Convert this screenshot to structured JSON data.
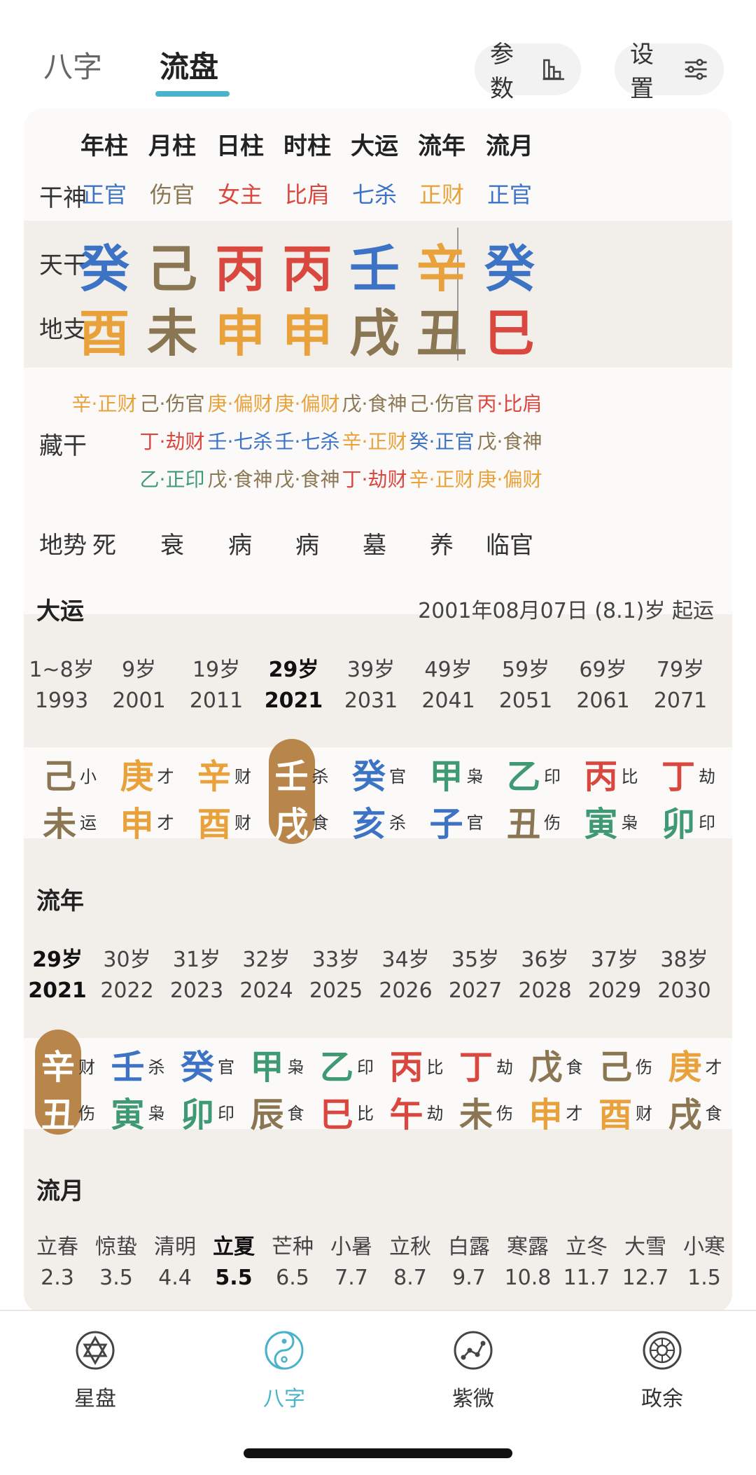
{
  "top_tabs": [
    {
      "label": "八字"
    },
    {
      "label": "流盘"
    }
  ],
  "top_buttons": {
    "params_label": "参数",
    "settings_label": "设置"
  },
  "pillars": {
    "headers": [
      "年柱",
      "月柱",
      "日柱",
      "时柱",
      "大运",
      "流年",
      "流月"
    ],
    "row_labels": {
      "gan_shen": "干神",
      "tian_gan": "天干",
      "di_zhi": "地支",
      "cang_gan": "藏干",
      "di_shi": "地势"
    },
    "gan_shen": [
      {
        "t": "正官",
        "c": "blue"
      },
      {
        "t": "伤官",
        "c": "brown"
      },
      {
        "t": "女主",
        "c": "red"
      },
      {
        "t": "比肩",
        "c": "red"
      },
      {
        "t": "七杀",
        "c": "blue"
      },
      {
        "t": "正财",
        "c": "orange"
      },
      {
        "t": "正官",
        "c": "blue"
      }
    ],
    "tian_gan": [
      {
        "t": "癸",
        "c": "blue"
      },
      {
        "t": "己",
        "c": "brown"
      },
      {
        "t": "丙",
        "c": "red"
      },
      {
        "t": "丙",
        "c": "red"
      },
      {
        "t": "壬",
        "c": "blue"
      },
      {
        "t": "辛",
        "c": "orange"
      },
      {
        "t": "癸",
        "c": "blue"
      }
    ],
    "di_zhi": [
      {
        "t": "酉",
        "c": "orange"
      },
      {
        "t": "未",
        "c": "brown"
      },
      {
        "t": "申",
        "c": "orange"
      },
      {
        "t": "申",
        "c": "orange"
      },
      {
        "t": "戌",
        "c": "brown"
      },
      {
        "t": "丑",
        "c": "brown"
      },
      {
        "t": "巳",
        "c": "red"
      }
    ],
    "cang_gan": [
      [
        {
          "t": "辛·正财",
          "c": "orange"
        }
      ],
      [
        {
          "t": "己·伤官",
          "c": "brown"
        },
        {
          "t": "丁·劫财",
          "c": "red"
        },
        {
          "t": "乙·正印",
          "c": "green"
        }
      ],
      [
        {
          "t": "庚·偏财",
          "c": "orange"
        },
        {
          "t": "壬·七杀",
          "c": "blue"
        },
        {
          "t": "戊·食神",
          "c": "brown"
        }
      ],
      [
        {
          "t": "庚·偏财",
          "c": "orange"
        },
        {
          "t": "壬·七杀",
          "c": "blue"
        },
        {
          "t": "戊·食神",
          "c": "brown"
        }
      ],
      [
        {
          "t": "戊·食神",
          "c": "brown"
        },
        {
          "t": "辛·正财",
          "c": "orange"
        },
        {
          "t": "丁·劫财",
          "c": "red"
        }
      ],
      [
        {
          "t": "己·伤官",
          "c": "brown"
        },
        {
          "t": "癸·正官",
          "c": "blue"
        },
        {
          "t": "辛·正财",
          "c": "orange"
        }
      ],
      [
        {
          "t": "丙·比肩",
          "c": "red"
        },
        {
          "t": "戊·食神",
          "c": "brown"
        },
        {
          "t": "庚·偏财",
          "c": "orange"
        }
      ]
    ],
    "di_shi": [
      "死",
      "衰",
      "病",
      "病",
      "墓",
      "养",
      "临官"
    ]
  },
  "dayun": {
    "title": "大运",
    "qiyun": "2001年08月07日 (8.1)岁 起运",
    "ages": [
      {
        "age": "1~8岁",
        "year": "1993"
      },
      {
        "age": "9岁",
        "year": "2001"
      },
      {
        "age": "19岁",
        "year": "2011"
      },
      {
        "age": "29岁",
        "year": "2021",
        "current": true
      },
      {
        "age": "39岁",
        "year": "2031"
      },
      {
        "age": "49岁",
        "year": "2041"
      },
      {
        "age": "59岁",
        "year": "2051"
      },
      {
        "age": "69岁",
        "year": "2061"
      },
      {
        "age": "79岁",
        "year": "2071"
      }
    ],
    "ganzhi": [
      {
        "g1": "己",
        "c1": "brown",
        "s1": "小",
        "g2": "未",
        "c2": "brown",
        "s2": "运"
      },
      {
        "g1": "庚",
        "c1": "orange",
        "s1": "才",
        "g2": "申",
        "c2": "orange",
        "s2": "才"
      },
      {
        "g1": "辛",
        "c1": "orange",
        "s1": "财",
        "g2": "酉",
        "c2": "orange",
        "s2": "财"
      },
      {
        "g1": "壬",
        "c1": "blue",
        "s1": "杀",
        "g2": "戌",
        "c2": "brown",
        "s2": "食",
        "current": true
      },
      {
        "g1": "癸",
        "c1": "blue",
        "s1": "官",
        "g2": "亥",
        "c2": "blue",
        "s2": "杀"
      },
      {
        "g1": "甲",
        "c1": "green",
        "s1": "枭",
        "g2": "子",
        "c2": "blue",
        "s2": "官"
      },
      {
        "g1": "乙",
        "c1": "green",
        "s1": "印",
        "g2": "丑",
        "c2": "brown",
        "s2": "伤"
      },
      {
        "g1": "丙",
        "c1": "red",
        "s1": "比",
        "g2": "寅",
        "c2": "green",
        "s2": "枭"
      },
      {
        "g1": "丁",
        "c1": "red",
        "s1": "劫",
        "g2": "卯",
        "c2": "green",
        "s2": "印"
      }
    ]
  },
  "liunian": {
    "title": "流年",
    "ages": [
      {
        "age": "29岁",
        "year": "2021",
        "current": true
      },
      {
        "age": "30岁",
        "year": "2022"
      },
      {
        "age": "31岁",
        "year": "2023"
      },
      {
        "age": "32岁",
        "year": "2024"
      },
      {
        "age": "33岁",
        "year": "2025"
      },
      {
        "age": "34岁",
        "year": "2026"
      },
      {
        "age": "35岁",
        "year": "2027"
      },
      {
        "age": "36岁",
        "year": "2028"
      },
      {
        "age": "37岁",
        "year": "2029"
      },
      {
        "age": "38岁",
        "year": "2030"
      }
    ],
    "ganzhi": [
      {
        "g1": "辛",
        "c1": "orange",
        "s1": "财",
        "g2": "丑",
        "c2": "brown",
        "s2": "伤",
        "current": true
      },
      {
        "g1": "壬",
        "c1": "blue",
        "s1": "杀",
        "g2": "寅",
        "c2": "green",
        "s2": "枭"
      },
      {
        "g1": "癸",
        "c1": "blue",
        "s1": "官",
        "g2": "卯",
        "c2": "green",
        "s2": "印"
      },
      {
        "g1": "甲",
        "c1": "green",
        "s1": "枭",
        "g2": "辰",
        "c2": "brown",
        "s2": "食"
      },
      {
        "g1": "乙",
        "c1": "green",
        "s1": "印",
        "g2": "巳",
        "c2": "red",
        "s2": "比"
      },
      {
        "g1": "丙",
        "c1": "red",
        "s1": "比",
        "g2": "午",
        "c2": "red",
        "s2": "劫"
      },
      {
        "g1": "丁",
        "c1": "red",
        "s1": "劫",
        "g2": "未",
        "c2": "brown",
        "s2": "伤"
      },
      {
        "g1": "戊",
        "c1": "brown",
        "s1": "食",
        "g2": "申",
        "c2": "orange",
        "s2": "才"
      },
      {
        "g1": "己",
        "c1": "brown",
        "s1": "伤",
        "g2": "酉",
        "c2": "orange",
        "s2": "财"
      },
      {
        "g1": "庚",
        "c1": "orange",
        "s1": "才",
        "g2": "戌",
        "c2": "brown",
        "s2": "食"
      }
    ]
  },
  "liuyue": {
    "title": "流月",
    "items": [
      {
        "name": "立春",
        "date": "2.3"
      },
      {
        "name": "惊蛰",
        "date": "3.5"
      },
      {
        "name": "清明",
        "date": "4.4"
      },
      {
        "name": "立夏",
        "date": "5.5",
        "current": true
      },
      {
        "name": "芒种",
        "date": "6.5"
      },
      {
        "name": "小暑",
        "date": "7.7"
      },
      {
        "name": "立秋",
        "date": "8.7"
      },
      {
        "name": "白露",
        "date": "9.7"
      },
      {
        "name": "寒露",
        "date": "10.8"
      },
      {
        "name": "立冬",
        "date": "11.7"
      },
      {
        "name": "大雪",
        "date": "12.7"
      },
      {
        "name": "小寒",
        "date": "1.5"
      }
    ]
  },
  "bottom_nav": [
    {
      "label": "星盘",
      "icon": "star-of-david-icon"
    },
    {
      "label": "八字",
      "icon": "yin-yang-icon",
      "active": true
    },
    {
      "label": "紫微",
      "icon": "constellation-icon"
    },
    {
      "label": "政余",
      "icon": "astrolabe-wheel-icon"
    }
  ],
  "colors": {
    "blue": "#3d73c4",
    "brown": "#8a7652",
    "red": "#d9473f",
    "orange": "#e9a23b",
    "green": "#3f9a73",
    "accent": "#4bb3c9",
    "highlight": "#b8864a"
  }
}
